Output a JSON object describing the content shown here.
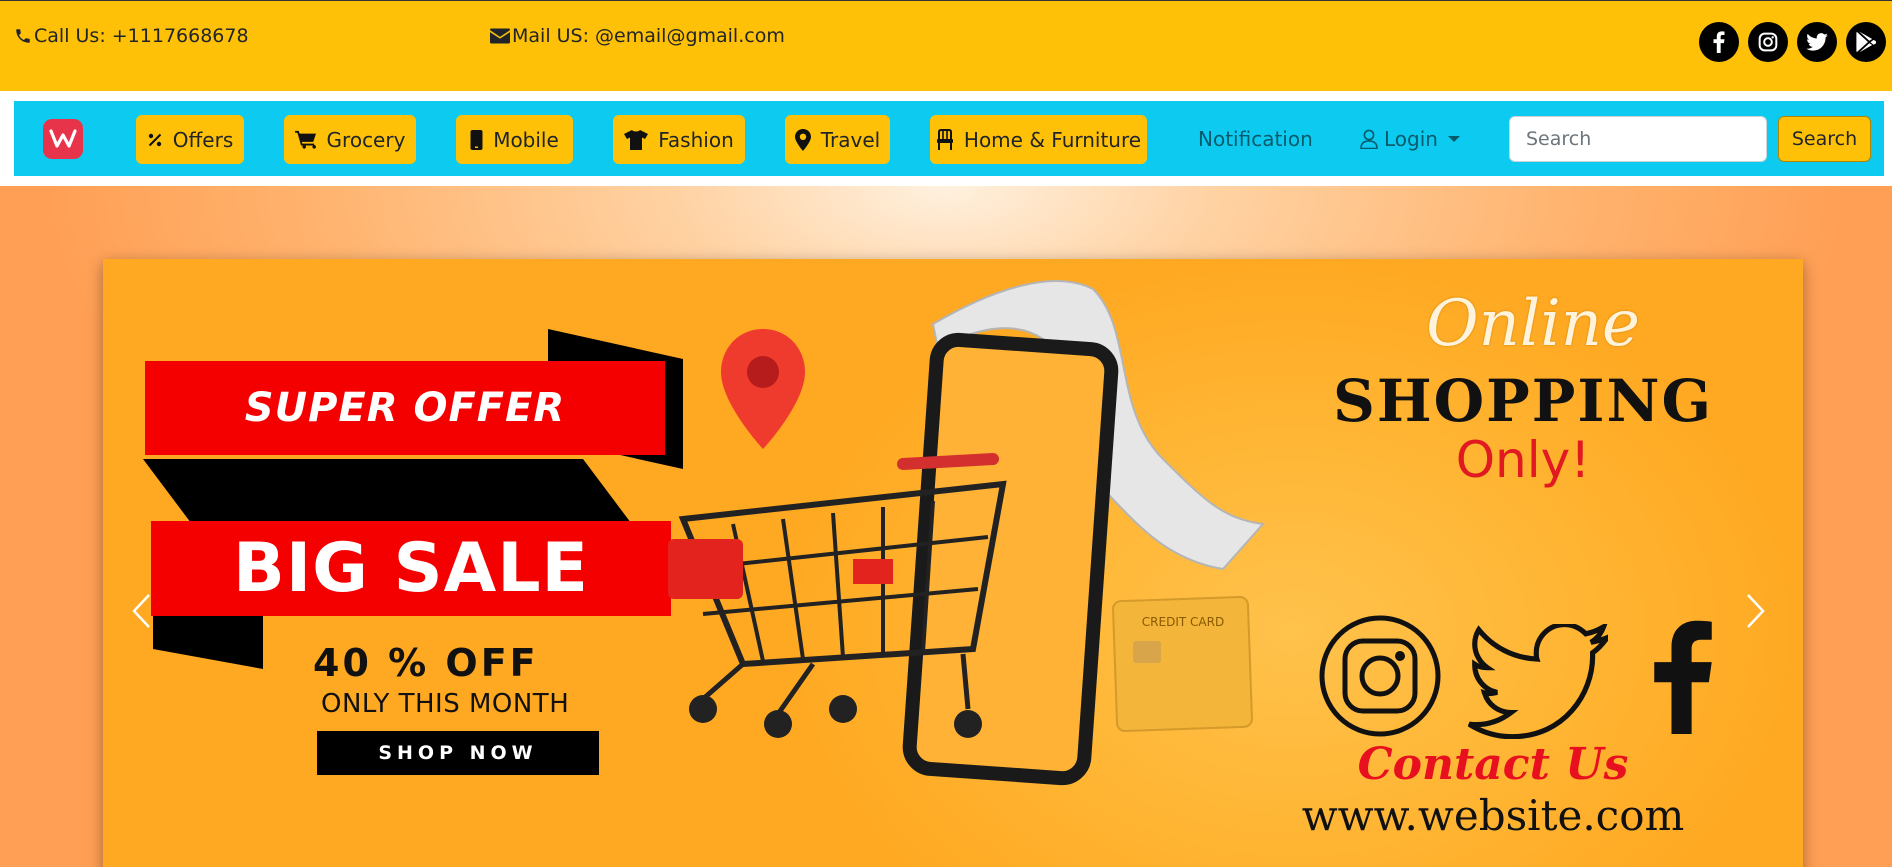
{
  "topbar": {
    "phone_label": "Call Us: +1117668678",
    "mail_label": "Mail US: @email@gmail.com",
    "socials": [
      "facebook-icon",
      "instagram-icon",
      "twitter-icon",
      "google-play-icon"
    ]
  },
  "navbar": {
    "brand_icon": "brand-logo-icon",
    "items": [
      {
        "label": "Offers",
        "icon": "percent-icon"
      },
      {
        "label": "Grocery",
        "icon": "cart-icon"
      },
      {
        "label": "Mobile",
        "icon": "phone-icon"
      },
      {
        "label": "Fashion",
        "icon": "shirt-icon"
      },
      {
        "label": "Travel",
        "icon": "location-pin-icon"
      },
      {
        "label": "Home & Furniture",
        "icon": "chair-icon"
      }
    ],
    "notification_label": "Notification",
    "login_label": "Login",
    "search_placeholder": "Search",
    "search_button_label": "Search"
  },
  "carousel": {
    "banner": {
      "super_offer": "SUPER OFFER",
      "big_sale": "BIG SALE",
      "discount": "40 % OFF",
      "period": "ONLY THIS MONTH",
      "shop_now": "SHOP NOW",
      "online": "Online",
      "shopping": "SHOPPING",
      "only": "Only!",
      "credit_card": "CREDIT CARD",
      "contact_us": "Contact Us",
      "website": "www.website.com"
    }
  },
  "colors": {
    "topbar": "#ffc107",
    "navbar": "#0dcaf0",
    "button": "#ffc107",
    "banner": "#ffb235",
    "sale_red": "#f50000"
  }
}
